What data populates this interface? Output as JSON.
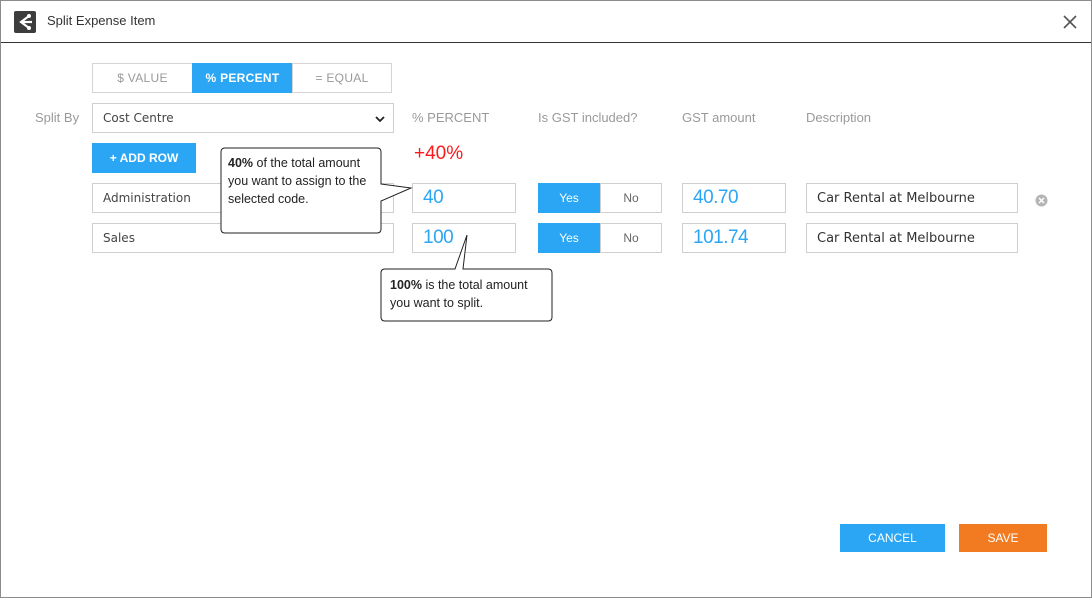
{
  "dialog": {
    "title": "Split Expense Item"
  },
  "split_mode": {
    "tabs": [
      "$ VALUE",
      "% PERCENT",
      "= EQUAL"
    ],
    "active": "% PERCENT"
  },
  "split_by": {
    "label": "Split By",
    "value": "Cost Centre"
  },
  "columns": {
    "percent": "% PERCENT",
    "gst_included": "Is GST included?",
    "gst_amount": "GST amount",
    "description": "Description"
  },
  "add_row_label": "+ ADD ROW",
  "total_percent": "+40%",
  "rows": [
    {
      "code": "Administration",
      "percent": "40",
      "yes": "Yes",
      "no": "No",
      "gst_included": "Yes",
      "gst_amount": "40.70",
      "description": "Car Rental at Melbourne"
    },
    {
      "code": "Sales",
      "percent": "100",
      "yes": "Yes",
      "no": "No",
      "gst_included": "Yes",
      "gst_amount": "101.74",
      "description": "Car Rental at Melbourne"
    }
  ],
  "callouts": [
    {
      "bold": "40%",
      "text": " of the total amount you want to assign to the selected code."
    },
    {
      "bold": "100%",
      "text": " is the total amount you want to split."
    }
  ],
  "buttons": {
    "cancel": "CANCEL",
    "save": "SAVE"
  },
  "colors": {
    "accent": "#2ba6f4",
    "save": "#f27b22",
    "total": "#ff1a1a"
  }
}
